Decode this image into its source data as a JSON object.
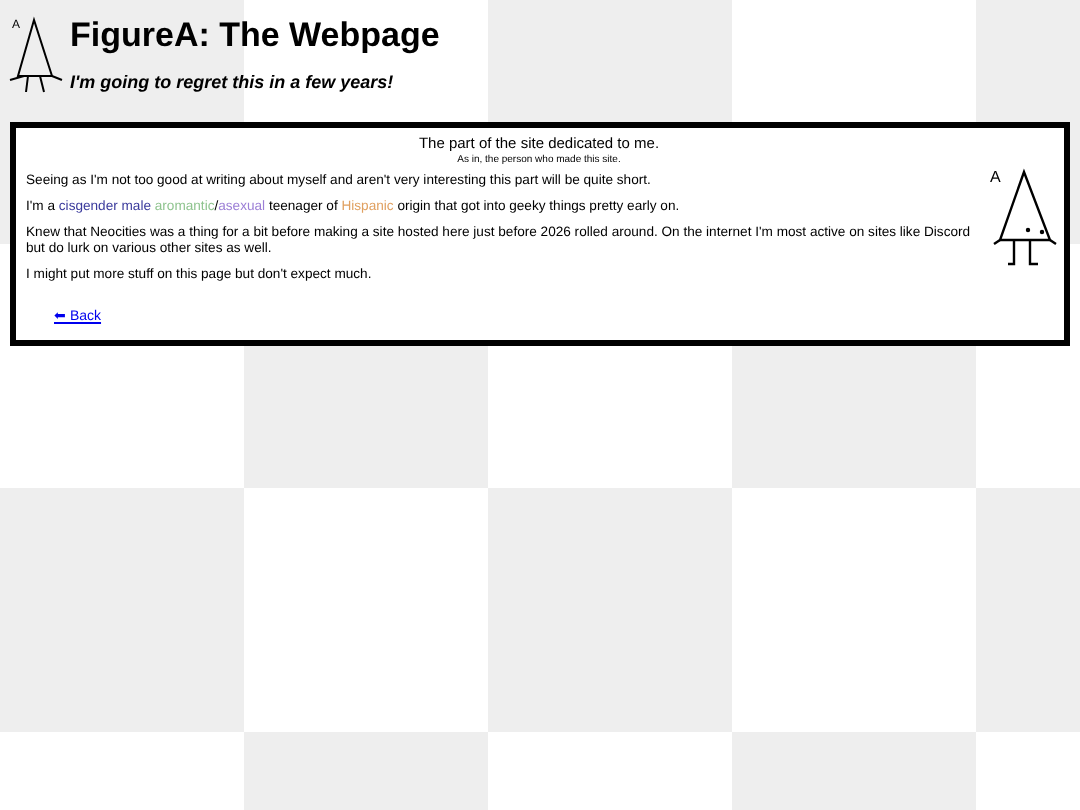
{
  "header": {
    "logo_letter": "A",
    "title": "FigureA: The Webpage",
    "subtitle": "I'm going to regret this in a few years!"
  },
  "about": {
    "heading": "The part of the site dedicated to me.",
    "subheading": "As in, the person who made this site.",
    "figure_letter": "A",
    "paragraphs": [
      [
        {
          "text": "Seeing as I'm not too good at writing about myself and aren't very interesting this part will be quite short."
        }
      ],
      [
        {
          "text": "I'm a "
        },
        {
          "text": "cisgender male ",
          "color": "#3a3a9c"
        },
        {
          "text": "aromantic",
          "color": "#8fc48f"
        },
        {
          "text": "/"
        },
        {
          "text": "asexual",
          "color": "#9c7fd6"
        },
        {
          "text": " teenager of "
        },
        {
          "text": "Hispanic",
          "color": "#e0a060"
        },
        {
          "text": " origin that got into geeky things pretty early on."
        }
      ],
      [
        {
          "text": "Knew that Neocities was a thing for a bit before making a site hosted here just before 2026 rolled around. On the internet I'm most active on sites like Discord but do lurk on various other sites as well."
        }
      ],
      [
        {
          "text": "I might put more stuff on this page but don't expect much."
        }
      ]
    ],
    "back_link": "⬅ Back"
  }
}
